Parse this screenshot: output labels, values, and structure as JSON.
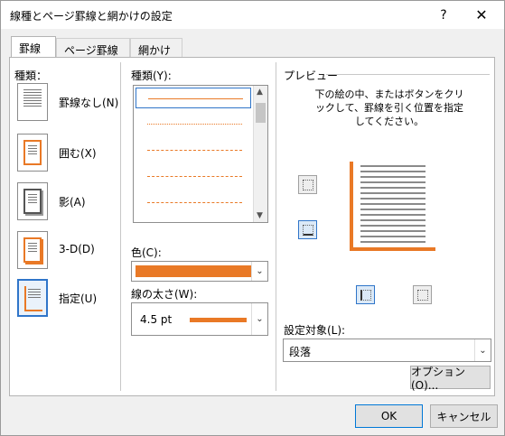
{
  "title": "線種とページ罫線と網かけの設定",
  "titlebar": {
    "help": "?",
    "close": "✕"
  },
  "tabs": [
    "罫線",
    "ページ罫線",
    "網かけ"
  ],
  "left": {
    "heading": "種類：",
    "settings": [
      "罫線なし(N)",
      "囲む(X)",
      "影(A)",
      "3-D(D)",
      "指定(U)"
    ]
  },
  "middle": {
    "style_label": "種類(Y):",
    "color_label": "色(C):",
    "width_label": "線の太さ(W):",
    "width_value": "4.5 pt",
    "accent": "#e97926"
  },
  "preview": {
    "heading": "プレビュー",
    "instruction": "下の絵の中、またはボタンをクリックして、罫線を引く位置を指定してください。",
    "apply_label": "設定対象(L):",
    "apply_value": "段落",
    "option_label": "オプション(O)..."
  },
  "buttons": {
    "ok": "OK",
    "cancel": "キャンセル"
  }
}
